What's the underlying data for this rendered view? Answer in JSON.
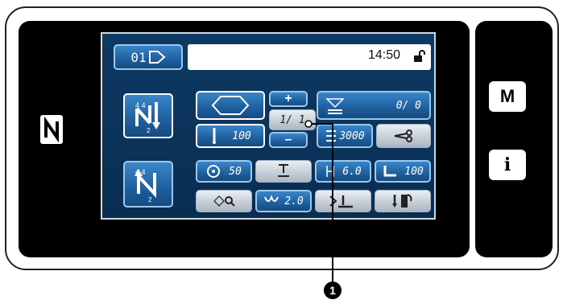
{
  "status": {
    "time": "14:50",
    "lock_icon": "unlock-icon"
  },
  "pattern": {
    "number": "01"
  },
  "counters": {
    "plus": "+",
    "minus": "–",
    "cycle": "1/ 1"
  },
  "bobbin": {
    "value": "0/ 0"
  },
  "values": {
    "stitch_count": "100",
    "thread_trim": "3000",
    "speed": "50",
    "pitch": "6.0",
    "presser": "100",
    "tension": "2.0"
  },
  "side_buttons": {
    "m_label": "M",
    "info_label": "i"
  },
  "callout": {
    "marker": "1"
  }
}
